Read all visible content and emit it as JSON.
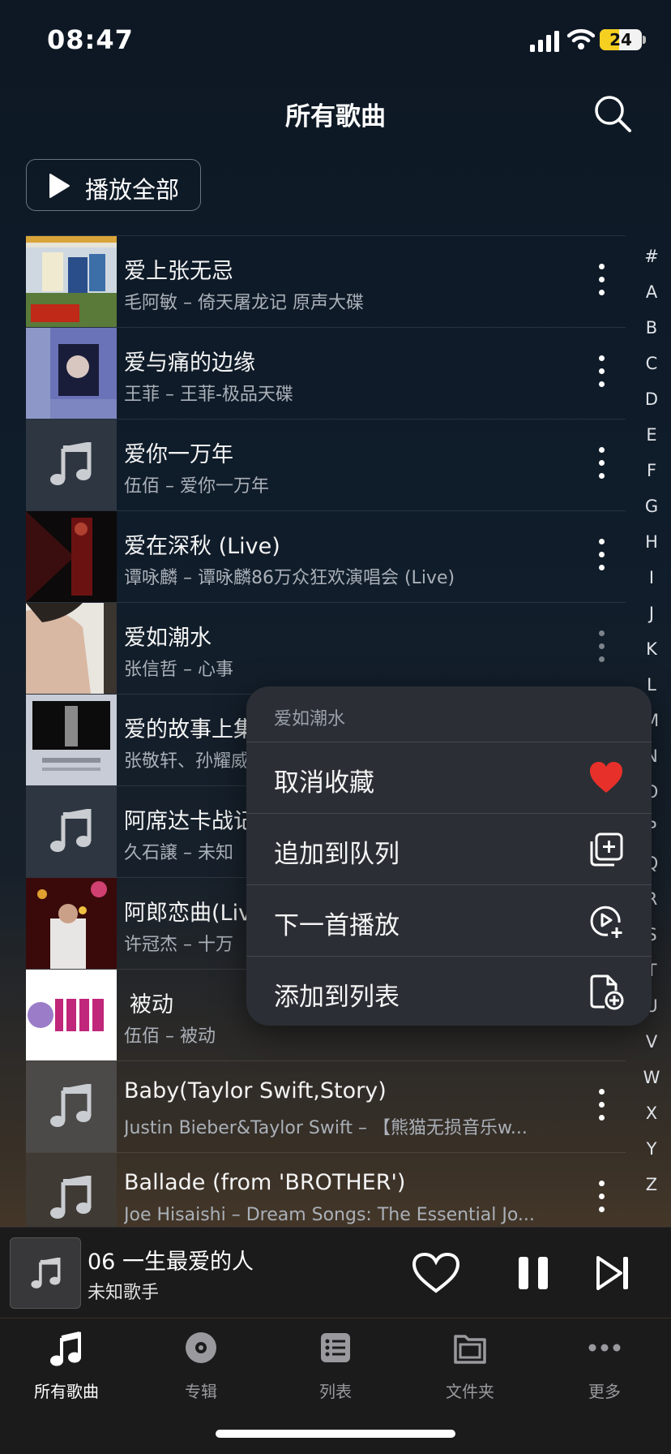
{
  "status": {
    "time": "08:47",
    "battery": "24"
  },
  "header": {
    "title": "所有歌曲",
    "play_all_label": "播放全部"
  },
  "songs": [
    {
      "title": "爱上张无忌",
      "subtitle": "毛阿敏 – 倚天屠龙记 原声大碟",
      "cover": "album-art"
    },
    {
      "title": "爱与痛的边缘",
      "subtitle": "王菲 – 王菲-极品天碟",
      "cover": "album-art"
    },
    {
      "title": "爱你一万年",
      "subtitle": "伍佰 – 爱你一万年",
      "cover": "placeholder"
    },
    {
      "title": "爱在深秋 (Live)",
      "subtitle": "谭咏麟 – 谭咏麟86万众狂欢演唱会 (Live)",
      "cover": "album-art"
    },
    {
      "title": "爱如潮水",
      "subtitle": "张信哲 – 心事",
      "cover": "album-art"
    },
    {
      "title": "爱的故事上集",
      "subtitle": "张敬轩、孙耀威",
      "cover": "album-art"
    },
    {
      "title": "阿席达卡战记",
      "subtitle": "久石譲 – 未知",
      "cover": "placeholder"
    },
    {
      "title": "阿郎恋曲(Live)",
      "subtitle": "许冠杰 – 十万",
      "cover": "album-art"
    },
    {
      "title": "被动",
      "subtitle": "伍佰 – 被动",
      "cover": "album-art"
    },
    {
      "title": "Baby(Taylor Swift,Story)",
      "subtitle": "Justin Bieber&Taylor Swift – 【熊猫无损音乐w...",
      "cover": "placeholder"
    },
    {
      "title": "Ballade (from 'BROTHER')",
      "subtitle": "Joe Hisaishi – Dream Songs: The Essential Jo...",
      "cover": "placeholder"
    }
  ],
  "alpha_index": [
    "#",
    "A",
    "B",
    "C",
    "D",
    "E",
    "F",
    "G",
    "H",
    "I",
    "J",
    "K",
    "L",
    "M",
    "N",
    "O",
    "P",
    "Q",
    "R",
    "S",
    "T",
    "U",
    "V",
    "W",
    "X",
    "Y",
    "Z"
  ],
  "context_menu": {
    "header": "爱如潮水",
    "items": [
      {
        "label": "取消收藏",
        "icon": "heart-filled-icon"
      },
      {
        "label": "追加到队列",
        "icon": "add-to-queue-icon"
      },
      {
        "label": "下一首播放",
        "icon": "play-next-icon"
      },
      {
        "label": "添加到列表",
        "icon": "add-to-playlist-icon"
      }
    ]
  },
  "player": {
    "title": "06 一生最爱的人",
    "artist": "未知歌手"
  },
  "tabs": [
    {
      "label": "所有歌曲",
      "icon": "music-note-icon",
      "active": true
    },
    {
      "label": "专辑",
      "icon": "album-icon",
      "active": false
    },
    {
      "label": "列表",
      "icon": "list-icon",
      "active": false
    },
    {
      "label": "文件夹",
      "icon": "folder-icon",
      "active": false
    },
    {
      "label": "更多",
      "icon": "more-icon",
      "active": false
    }
  ],
  "colors": {
    "accent_heart": "#e8302a",
    "background": "#0f1c2a",
    "bar_background": "#1b1b1c"
  }
}
